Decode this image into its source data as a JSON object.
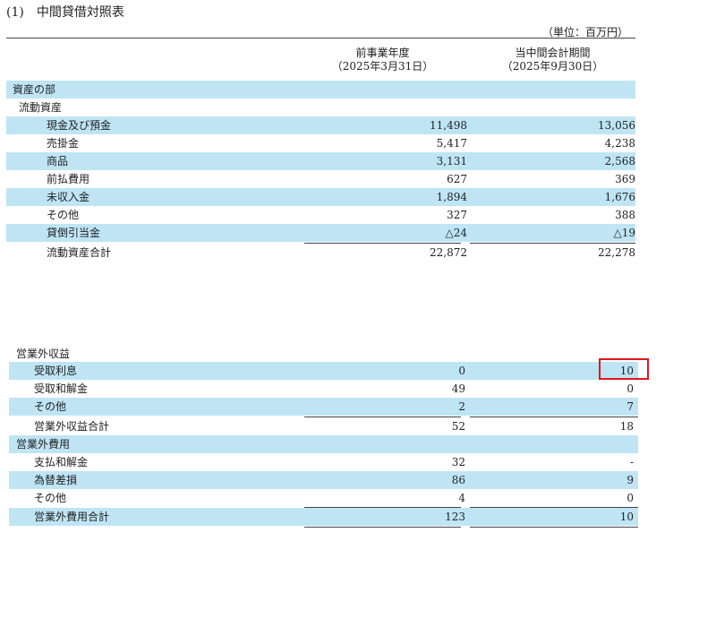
{
  "page_title": "(1)　中間貸借対照表",
  "unit_note": "（単位：百万円）",
  "columns": {
    "prior": {
      "title": "前事業年度",
      "date": "（2025年3月31日）"
    },
    "current": {
      "title": "当中間会計期間",
      "date": "（2025年9月30日）"
    }
  },
  "balance_sheet": {
    "section_title": "資産の部",
    "group_title": "流動資産",
    "rows": [
      {
        "label": "現金及び預金",
        "prior": "11,498",
        "current": "13,056"
      },
      {
        "label": "売掛金",
        "prior": "5,417",
        "current": "4,238"
      },
      {
        "label": "商品",
        "prior": "3,131",
        "current": "2,568"
      },
      {
        "label": "前払費用",
        "prior": "627",
        "current": "369"
      },
      {
        "label": "未収入金",
        "prior": "1,894",
        "current": "1,676"
      },
      {
        "label": "その他",
        "prior": "327",
        "current": "388"
      },
      {
        "label": "貸倒引当金",
        "prior": "△24",
        "current": "△19"
      }
    ],
    "total": {
      "label": "流動資産合計",
      "prior": "22,872",
      "current": "22,278"
    }
  },
  "non_operating_income": {
    "title": "営業外収益",
    "rows": [
      {
        "label": "受取利息",
        "prior": "0",
        "current": "10"
      },
      {
        "label": "受取和解金",
        "prior": "49",
        "current": "0"
      },
      {
        "label": "その他",
        "prior": "2",
        "current": "7"
      }
    ],
    "total": {
      "label": "営業外収益合計",
      "prior": "52",
      "current": "18"
    }
  },
  "non_operating_expenses": {
    "title": "営業外費用",
    "rows": [
      {
        "label": "支払和解金",
        "prior": "32",
        "current": "-"
      },
      {
        "label": "為替差損",
        "prior": "86",
        "current": "9"
      },
      {
        "label": "その他",
        "prior": "4",
        "current": "0"
      }
    ],
    "total": {
      "label": "営業外費用合計",
      "prior": "123",
      "current": "10"
    }
  },
  "colors": {
    "row_shade": "#bfe5f5",
    "highlight_box": "#e0161f"
  }
}
